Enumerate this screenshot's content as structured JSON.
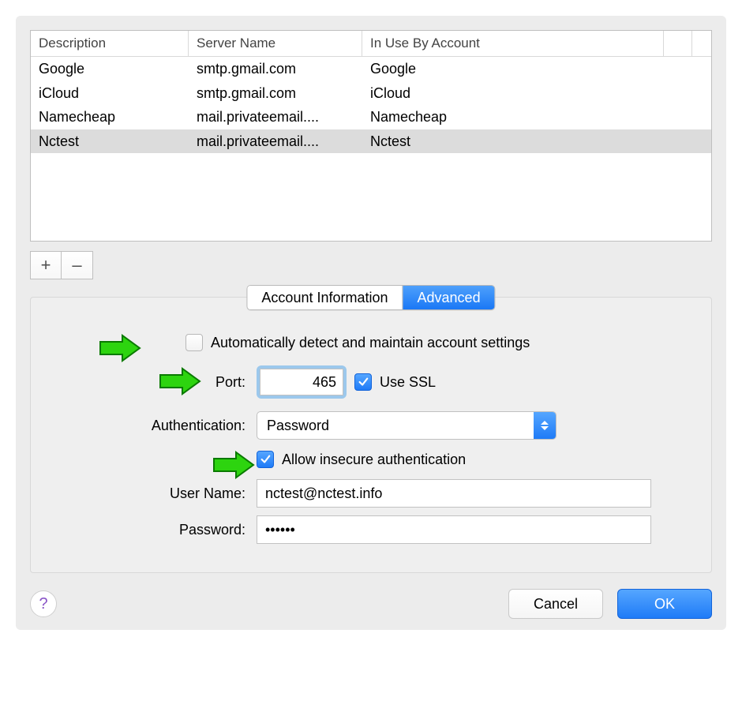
{
  "table": {
    "headers": {
      "description": "Description",
      "server": "Server Name",
      "inuse": "In Use By Account"
    },
    "rows": [
      {
        "description": "Google",
        "server": "smtp.gmail.com",
        "inuse": "Google",
        "selected": false
      },
      {
        "description": "iCloud",
        "server": "smtp.gmail.com",
        "inuse": "iCloud",
        "selected": false
      },
      {
        "description": "Namecheap",
        "server": "mail.privateemail....",
        "inuse": "Namecheap",
        "selected": false
      },
      {
        "description": "Nctest",
        "server": "mail.privateemail....",
        "inuse": "Nctest",
        "selected": true
      }
    ]
  },
  "tabs": {
    "account_info": "Account Information",
    "advanced": "Advanced",
    "active": "advanced"
  },
  "form": {
    "auto_detect": {
      "label": "Automatically detect and maintain account settings",
      "checked": false
    },
    "port": {
      "label": "Port:",
      "value": "465"
    },
    "use_ssl": {
      "label": "Use SSL",
      "checked": true
    },
    "authentication": {
      "label": "Authentication:",
      "value": "Password"
    },
    "allow_insecure": {
      "label": "Allow insecure authentication",
      "checked": true
    },
    "username": {
      "label": "User Name:",
      "value": "nctest@nctest.info"
    },
    "password": {
      "label": "Password:",
      "value": "••••••"
    }
  },
  "buttons": {
    "add": "+",
    "remove": "–",
    "help": "?",
    "cancel": "Cancel",
    "ok": "OK"
  }
}
